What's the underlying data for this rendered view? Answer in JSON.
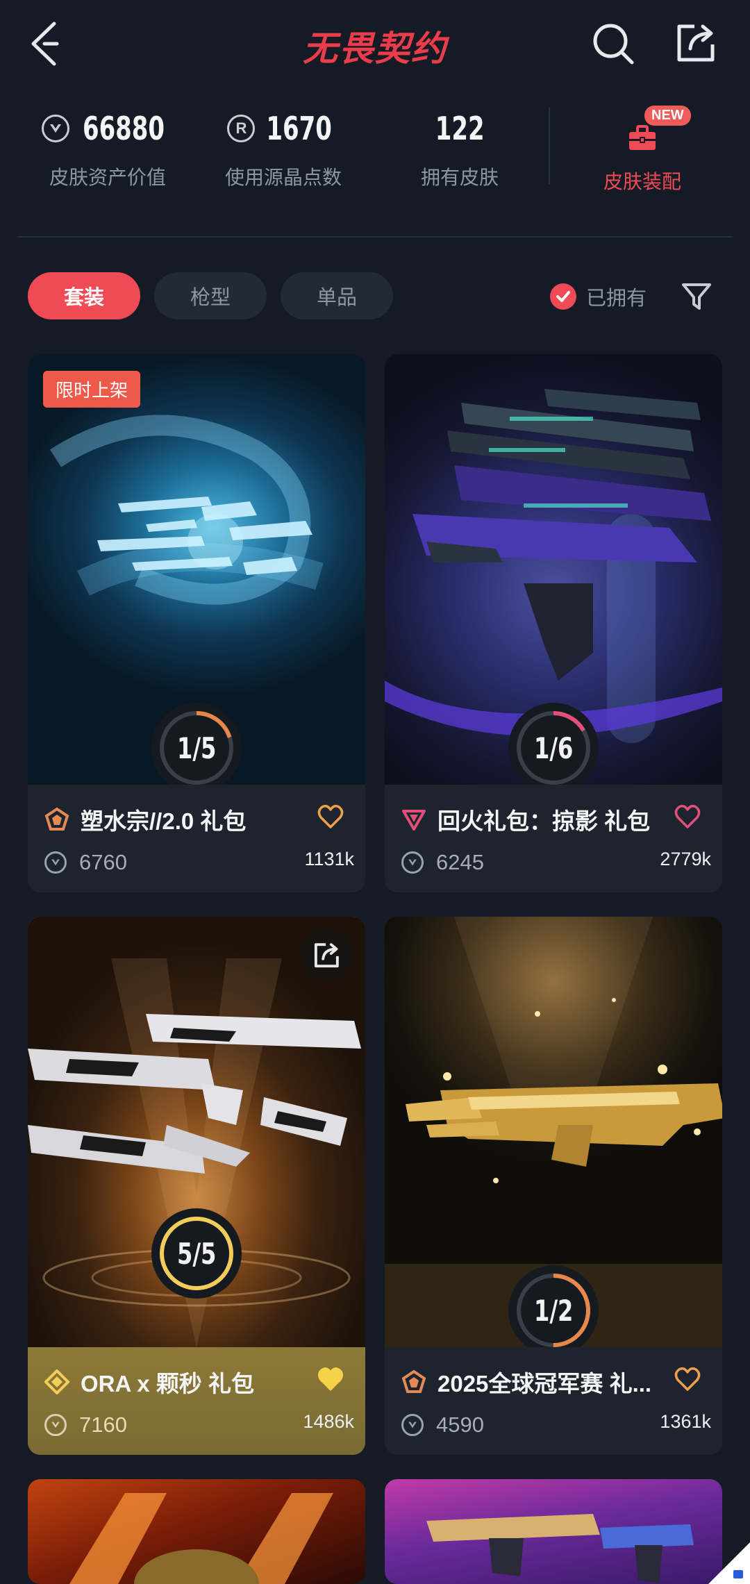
{
  "header": {
    "title": "无畏契约",
    "icons": {
      "back": "back-icon",
      "search": "search-icon",
      "share": "share-icon"
    }
  },
  "stats": [
    {
      "value": "66880",
      "label": "皮肤资产价值",
      "icon": "vp-coin-icon"
    },
    {
      "value": "1670",
      "label": "使用源晶点数",
      "icon": "radianite-icon"
    },
    {
      "value": "122",
      "label": "拥有皮肤",
      "icon": ""
    }
  ],
  "loadout": {
    "label": "皮肤装配",
    "badge": "NEW",
    "icon": "toolbox-icon"
  },
  "tabs": [
    {
      "label": "套装",
      "active": true
    },
    {
      "label": "枪型",
      "active": false
    },
    {
      "label": "单品",
      "active": false
    }
  ],
  "owned_filter": {
    "label": "已拥有",
    "checked": true
  },
  "cards": [
    {
      "name": "塑水宗//2.0 礼包",
      "price": "6760",
      "likes": "1131k",
      "owned": "1",
      "total": "5",
      "progress_text": "1/5",
      "tag": "限时上架",
      "tier": "tier-pentagon-icon",
      "favorited": false
    },
    {
      "name": "回火礼包：掠影 礼包",
      "price": "6245",
      "likes": "2779k",
      "owned": "1",
      "total": "6",
      "progress_text": "1/6",
      "tag": "",
      "tier": "tier-triangle-icon",
      "favorited": false
    },
    {
      "name": "ORA x 颗秒 礼包",
      "price": "7160",
      "likes": "1486k",
      "owned": "5",
      "total": "5",
      "progress_text": "5/5",
      "tag": "",
      "tier": "tier-diamond-icon",
      "favorited": true
    },
    {
      "name": "2025全球冠军赛 礼...",
      "price": "4590",
      "likes": "1361k",
      "owned": "1",
      "total": "2",
      "progress_text": "1/2",
      "tag": "",
      "tier": "tier-pentagon-icon",
      "favorited": false
    }
  ],
  "colors": {
    "accent": "#ef4a55",
    "background": "#141b24",
    "card": "#1d242e",
    "gold_card": "#8a7436"
  }
}
